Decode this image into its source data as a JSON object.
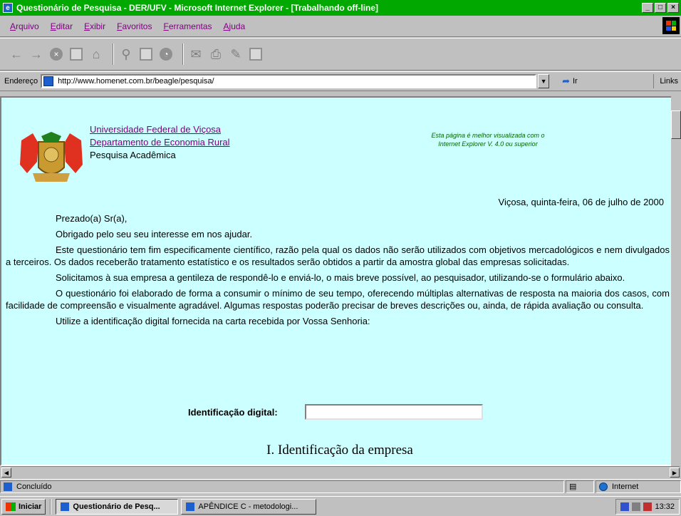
{
  "window": {
    "title": "Questionário de Pesquisa - DER/UFV - Microsoft Internet Explorer - [Trabalhando off-line]",
    "buttons": [
      "_",
      "□",
      "×"
    ]
  },
  "menu": [
    "Arquivo",
    "Editar",
    "Exibir",
    "Favoritos",
    "Ferramentas",
    "Ajuda"
  ],
  "toolbar": {
    "icons": [
      "back-icon",
      "forward-icon",
      "stop-icon",
      "refresh-icon",
      "home-icon",
      "search-icon",
      "favorites-icon",
      "history-icon",
      "mail-icon",
      "print-icon",
      "edit-icon",
      "discuss-icon"
    ]
  },
  "address": {
    "label": "Endereço",
    "url": "http://www.homenet.com.br/beagle/pesquisa/",
    "go_label": "Ir",
    "links_label": "Links"
  },
  "page": {
    "university": "Universidade Federal de Viçosa",
    "department": "Departamento de Economia Rural",
    "subtitle": "Pesquisa Acadêmica",
    "best_view_line1": "Esta página é melhor visualizada com o",
    "best_view_line2": "Internet Explorer V. 4.0 ou superior",
    "date": "Viçosa, quinta-feira, 06 de julho de 2000",
    "paragraphs": [
      "Prezado(a) Sr(a),",
      "Obrigado pelo seu seu interesse em nos ajudar.",
      "Este questionário tem fim especificamente científico, razão pela qual os dados não serão utilizados com objetivos mercadológicos e nem divulgados a terceiros. Os dados receberão tratamento estatístico e os resultados serão obtidos a partir da amostra global das empresas solicitadas.",
      "Solicitamos à sua empresa a gentileza de respondê-lo e enviá-lo, o mais breve possível, ao pesquisador, utilizando-se o formulário abaixo.",
      "O questionário foi elaborado de forma a consumir o mínimo de seu tempo, oferecendo múltiplas alternativas de resposta na maioria dos casos, com facilidade de compreensão e visualmente agradável. Algumas respostas poderão precisar de breves descrições ou, ainda, de rápida avaliação ou consulta.",
      "Utilize a identificação digital fornecida na carta recebida por Vossa Senhoria:"
    ],
    "id_label": "Identificação digital:",
    "id_value": "",
    "section_title": "I. Identificação da empresa"
  },
  "status": {
    "text": "Concluído",
    "zone": "Internet"
  },
  "taskbar": {
    "start": "Iniciar",
    "tasks": [
      "Questionário de Pesq...",
      "APÊNDICE C - metodologi..."
    ],
    "clock": "13:32"
  }
}
